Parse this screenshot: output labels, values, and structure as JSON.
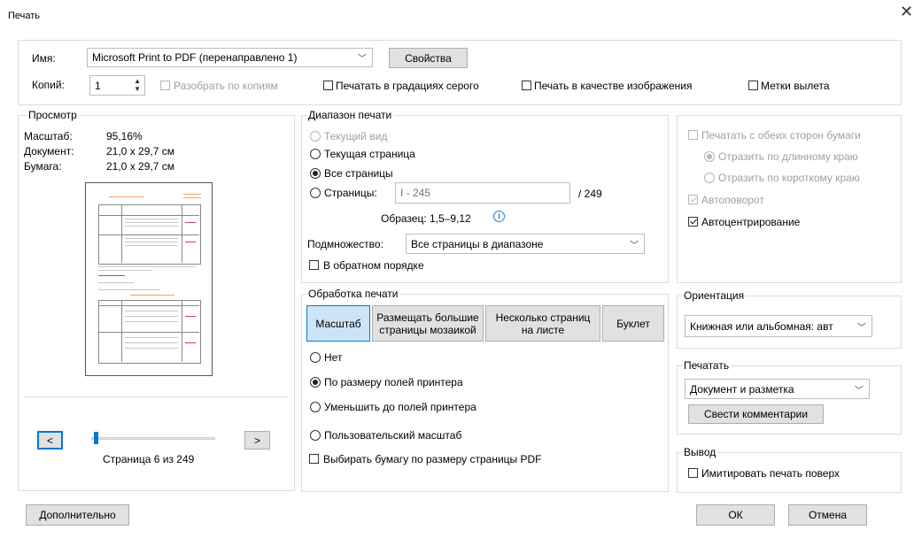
{
  "window": {
    "title": "Печать",
    "close_glyph": "✕"
  },
  "printer": {
    "name_label": "Имя:",
    "name_value": "Microsoft Print to PDF (перенаправлено 1)",
    "properties_button": "Свойства",
    "copies_label": "Копий:",
    "copies_value": "1",
    "collate_label": "Разобрать по копиям",
    "grayscale_label": "Печатать в градациях серого",
    "as_image_label": "Печать в качестве изображения",
    "bleed_marks_label": "Метки вылета"
  },
  "preview": {
    "legend": "Просмотр",
    "scale_label": "Масштаб:",
    "scale_value": "95,16%",
    "document_label": "Документ:",
    "document_value": "21,0 x 29,7 см",
    "paper_label": "Бумага:",
    "paper_value": "21,0 x 29,7 см",
    "prev_button": "<",
    "next_button": ">",
    "page_status": "Страница 6 из 249",
    "slider_position": 0.02
  },
  "range": {
    "legend": "Диапазон печати",
    "current_view": "Текущий вид",
    "current_page": "Текущая страница",
    "all_pages": "Все страницы",
    "pages_label": "Страницы:",
    "pages_placeholder": "I - 245",
    "pages_total": "/ 249",
    "sample_text": "Образец: 1,5–9,12",
    "subset_label": "Подмножество:",
    "subset_value": "Все страницы в диапазоне",
    "reverse_label": "В обратном порядке"
  },
  "handling": {
    "legend": "Обработка печати",
    "tabs": [
      {
        "label": "Масштаб"
      },
      {
        "label": "Размещать большие страницы мозаикой"
      },
      {
        "label": "Несколько страниц на листе"
      },
      {
        "label": "Буклет"
      }
    ],
    "none": "Нет",
    "fit_margins": "По размеру полей принтера",
    "shrink_margins": "Уменьшить до полей принтера",
    "custom_scale": "Пользовательский масштаб",
    "choose_paper": "Выбирать бумагу по размеру страницы PDF"
  },
  "duplex": {
    "both_sides": "Печатать с обеих сторон бумаги",
    "long_edge": "Отразить по длинному краю",
    "short_edge": "Отразить по короткому краю",
    "autorotate": "Автоповорот",
    "autocenter": "Автоцентрирование"
  },
  "orientation": {
    "legend": "Ориентация",
    "value": "Книжная или альбомная: авт"
  },
  "print_what": {
    "legend": "Печатать",
    "value": "Документ и разметка",
    "summarize_button": "Свести комментарии"
  },
  "output": {
    "legend": "Вывод",
    "simulate_overprint": "Имитировать печать поверх"
  },
  "footer": {
    "advanced_button": "Дополнительно",
    "ok_button": "ОК",
    "cancel_button": "Отмена"
  }
}
